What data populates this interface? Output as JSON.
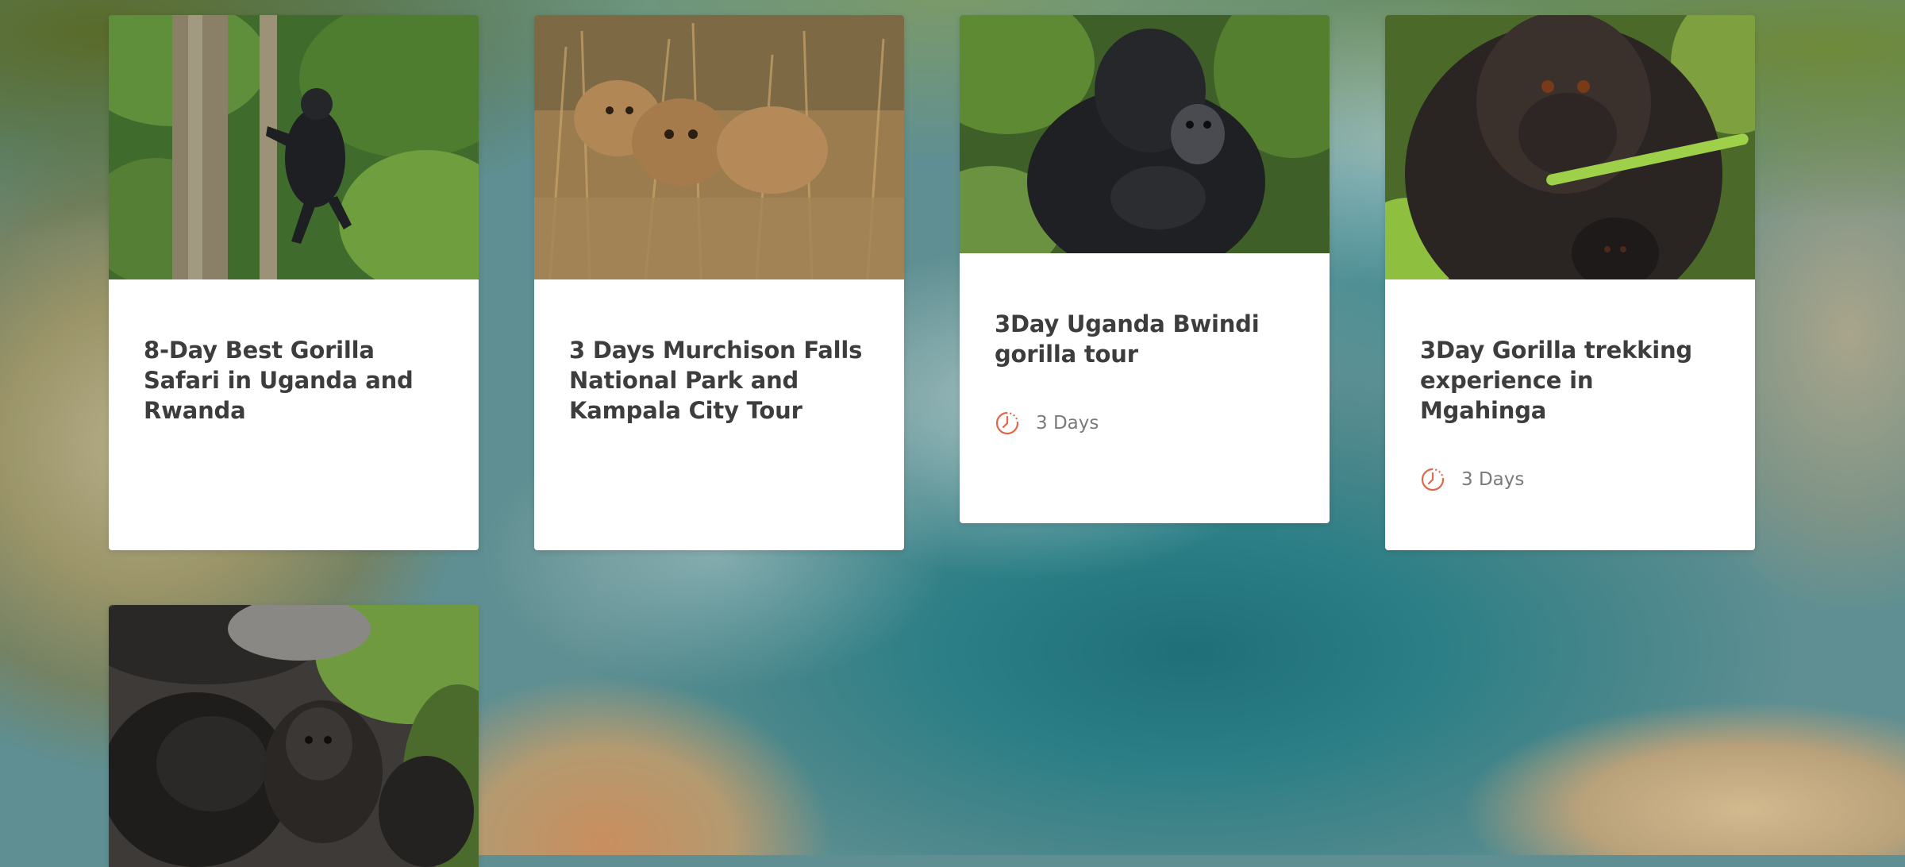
{
  "tours": [
    {
      "title": "8-Day Best Gorilla Safari in Uganda and Rwanda",
      "duration": ""
    },
    {
      "title": "3 Days Murchison Falls National Park and Kampala City Tour",
      "duration": ""
    },
    {
      "title": "3Day Uganda Bwindi gorilla tour",
      "duration": "3 Days"
    },
    {
      "title": "3Day Gorilla trekking experience in Mgahinga",
      "duration": "3 Days"
    },
    {
      "title": "",
      "duration": ""
    }
  ],
  "icons": {
    "duration": "clock-icon"
  },
  "colors": {
    "accent": "#e2674a",
    "title": "#3d3d3d",
    "meta": "#7a7a7a",
    "card": "#ffffff"
  }
}
